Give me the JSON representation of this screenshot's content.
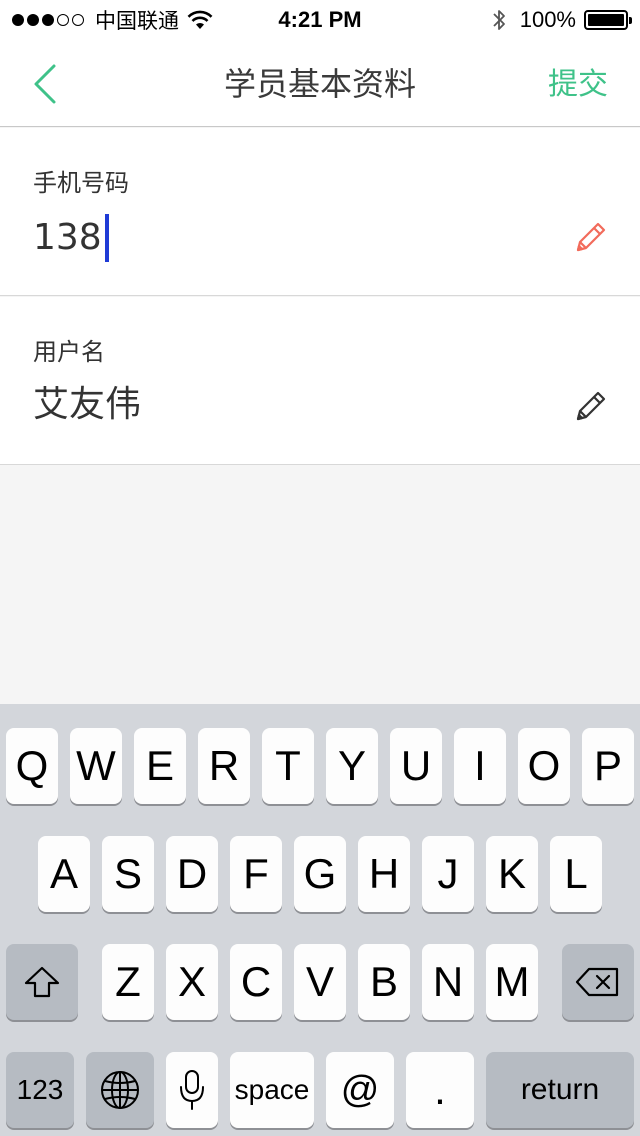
{
  "status_bar": {
    "carrier": "中国联通",
    "time": "4:21 PM",
    "battery": "100%",
    "signal_strength": 3,
    "signal_max": 5
  },
  "nav": {
    "title": "学员基本资料",
    "submit_label": "提交",
    "back_icon": "chevron-left-icon",
    "accent_color": "#3fc289"
  },
  "form": {
    "phone": {
      "label": "手机号码",
      "value": "138",
      "edit_icon": "pencil-icon",
      "icon_color": "#f26b5b"
    },
    "username": {
      "label": "用户名",
      "value": "艾友伟",
      "edit_icon": "pencil-icon",
      "icon_color": "#333333"
    }
  },
  "keyboard": {
    "row1": [
      "Q",
      "W",
      "E",
      "R",
      "T",
      "Y",
      "U",
      "I",
      "O",
      "P"
    ],
    "row2": [
      "A",
      "S",
      "D",
      "F",
      "G",
      "H",
      "J",
      "K",
      "L"
    ],
    "row3": [
      "Z",
      "X",
      "C",
      "V",
      "B",
      "N",
      "M"
    ],
    "shift_icon": "shift-icon",
    "delete_icon": "backspace-icon",
    "numbers_label": "123",
    "globe_icon": "globe-icon",
    "mic_icon": "microphone-icon",
    "space_label": "space",
    "at_label": "@",
    "dot_label": ".",
    "return_label": "return"
  }
}
